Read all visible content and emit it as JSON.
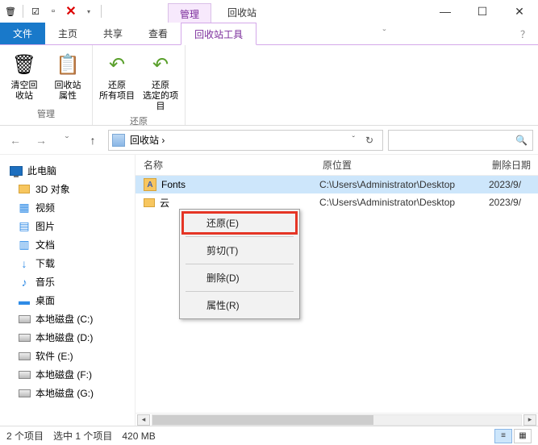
{
  "titlebar": {
    "qat_x": "✕",
    "manage_tab": "管理",
    "window_title": "回收站",
    "min": "—",
    "max": "☐",
    "close": "✕"
  },
  "tabs": {
    "file": "文件",
    "home": "主页",
    "share": "共享",
    "view": "查看",
    "tools": "回收站工具",
    "help": "ˇ",
    "help2": "？"
  },
  "ribbon": {
    "empty": "清空回\n收站",
    "props": "回收站\n属性",
    "restore_all": "还原\n所有项目",
    "restore_sel": "还原\n选定的项目",
    "grp_manage": "管理",
    "grp_restore": "还原"
  },
  "nav": {
    "back": "←",
    "fwd": "→",
    "hist": "ˇ",
    "up": "↑",
    "path": "回收站  ›",
    "search_ph": "",
    "search_icon": "🔍"
  },
  "tree": {
    "this_pc": "此电脑",
    "items": [
      {
        "label": "3D 对象",
        "icon": "folder"
      },
      {
        "label": "视频",
        "icon": "blue",
        "glyph": "▦"
      },
      {
        "label": "图片",
        "icon": "blue",
        "glyph": "▤"
      },
      {
        "label": "文档",
        "icon": "blue",
        "glyph": "▥"
      },
      {
        "label": "下载",
        "icon": "blue",
        "glyph": "↓"
      },
      {
        "label": "音乐",
        "icon": "blue",
        "glyph": "♪"
      },
      {
        "label": "桌面",
        "icon": "blue",
        "glyph": "▬"
      },
      {
        "label": "本地磁盘 (C:)",
        "icon": "drive"
      },
      {
        "label": "本地磁盘 (D:)",
        "icon": "drive"
      },
      {
        "label": "软件 (E:)",
        "icon": "drive"
      },
      {
        "label": "本地磁盘 (F:)",
        "icon": "drive"
      },
      {
        "label": "本地磁盘 (G:)",
        "icon": "drive"
      }
    ]
  },
  "cols": {
    "name": "名称",
    "loc": "原位置",
    "date": "删除日期"
  },
  "rows": [
    {
      "name": "Fonts",
      "loc": "C:\\Users\\Administrator\\Desktop",
      "date": "2023/9/",
      "icon": "A",
      "sel": true
    },
    {
      "name": "云",
      "loc": "C:\\Users\\Administrator\\Desktop",
      "date": "2023/9/",
      "icon": "",
      "sel": false
    }
  ],
  "ctx": {
    "restore": "还原(E)",
    "cut": "剪切(T)",
    "delete": "删除(D)",
    "props": "属性(R)"
  },
  "status": {
    "count": "2 个项目",
    "sel": "选中 1 个项目",
    "size": "420 MB"
  }
}
